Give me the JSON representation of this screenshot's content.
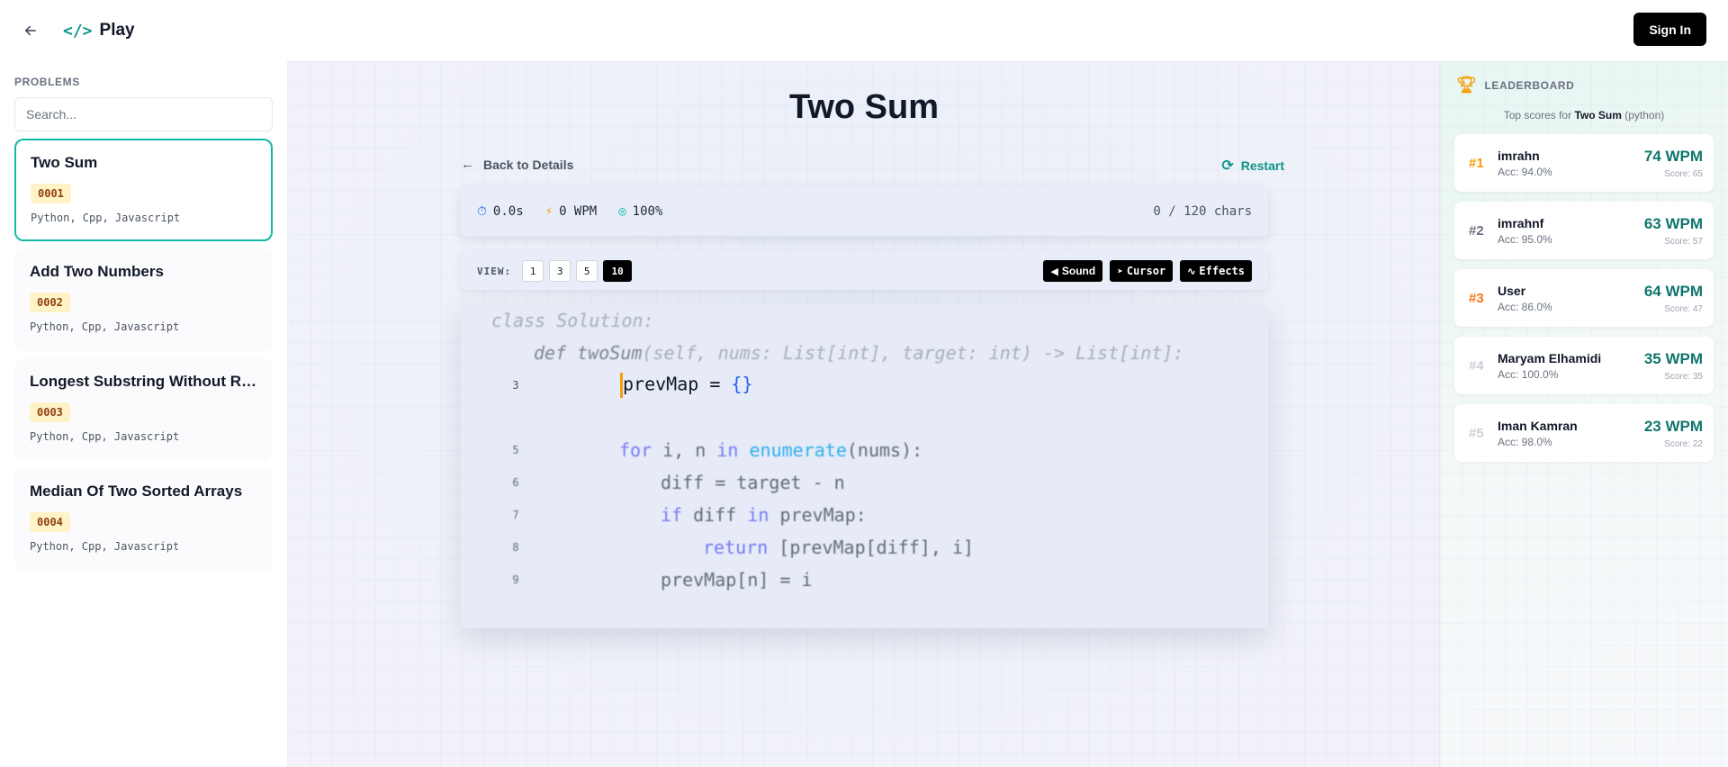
{
  "header": {
    "brand_icon": "</>",
    "brand_name": "Play",
    "signin_label": "Sign In"
  },
  "sidebar": {
    "heading": "PROBLEMS",
    "search_placeholder": "Search...",
    "problems": [
      {
        "title": "Two Sum",
        "id": "0001",
        "langs": "Python, Cpp, Javascript",
        "active": true
      },
      {
        "title": "Add Two Numbers",
        "id": "0002",
        "langs": "Python, Cpp, Javascript"
      },
      {
        "title": "Longest Substring Without Re...",
        "id": "0003",
        "langs": "Python, Cpp, Javascript"
      },
      {
        "title": "Median Of Two Sorted Arrays",
        "id": "0004",
        "langs": "Python, Cpp, Javascript"
      }
    ]
  },
  "main": {
    "title": "Two Sum",
    "back_label": "Back to Details",
    "restart_label": "Restart",
    "stats": {
      "time": "0.0s",
      "wpm": "0 WPM",
      "accuracy": "100%",
      "chars": "0 / 120 chars"
    },
    "view": {
      "label": "VIEW:",
      "options": [
        "1",
        "3",
        "5",
        "10"
      ],
      "selected": "10"
    },
    "tools": {
      "sound": "Sound",
      "cursor": "Cursor",
      "effects": "Effects"
    },
    "code": {
      "line1": "class Solution:",
      "line2_def": "def ",
      "line2_fn": "twoSum",
      "line2_rest": "(self, nums: List[int], target: int) -> List[int]:",
      "line3_no": "3",
      "line3_code": "prevMap = ",
      "line3_br": "{}",
      "line5_no": "5",
      "line5_for": "for",
      "line5_mid": " i, n ",
      "line5_in": "in",
      "line5_sp": " ",
      "line5_fn": "enumerate",
      "line5_rest": "(nums):",
      "line6_no": "6",
      "line6_code": "diff = target - n",
      "line7_no": "7",
      "line7_if": "if",
      "line7_mid": " diff ",
      "line7_in": "in",
      "line7_rest": " prevMap:",
      "line8_no": "8",
      "line8_ret": "return",
      "line8_rest": " [prevMap[diff], i]",
      "line9_no": "9",
      "line9_code": "prevMap[n] = i"
    }
  },
  "leaderboard": {
    "heading": "LEADERBOARD",
    "sub_prefix": "Top scores for ",
    "sub_problem": "Two Sum",
    "sub_lang": " (python)",
    "entries": [
      {
        "rank": "#1",
        "name": "imrahn",
        "acc": "Acc: 94.0%",
        "wpm": "74 WPM",
        "score": "Score: 65"
      },
      {
        "rank": "#2",
        "name": "imrahnf",
        "acc": "Acc: 95.0%",
        "wpm": "63 WPM",
        "score": "Score: 57"
      },
      {
        "rank": "#3",
        "name": "User",
        "acc": "Acc: 86.0%",
        "wpm": "64 WPM",
        "score": "Score: 47"
      },
      {
        "rank": "#4",
        "name": "Maryam Elhamidi",
        "acc": "Acc: 100.0%",
        "wpm": "35 WPM",
        "score": "Score: 35"
      },
      {
        "rank": "#5",
        "name": "Iman Kamran",
        "acc": "Acc: 98.0%",
        "wpm": "23 WPM",
        "score": "Score: 22"
      }
    ]
  }
}
